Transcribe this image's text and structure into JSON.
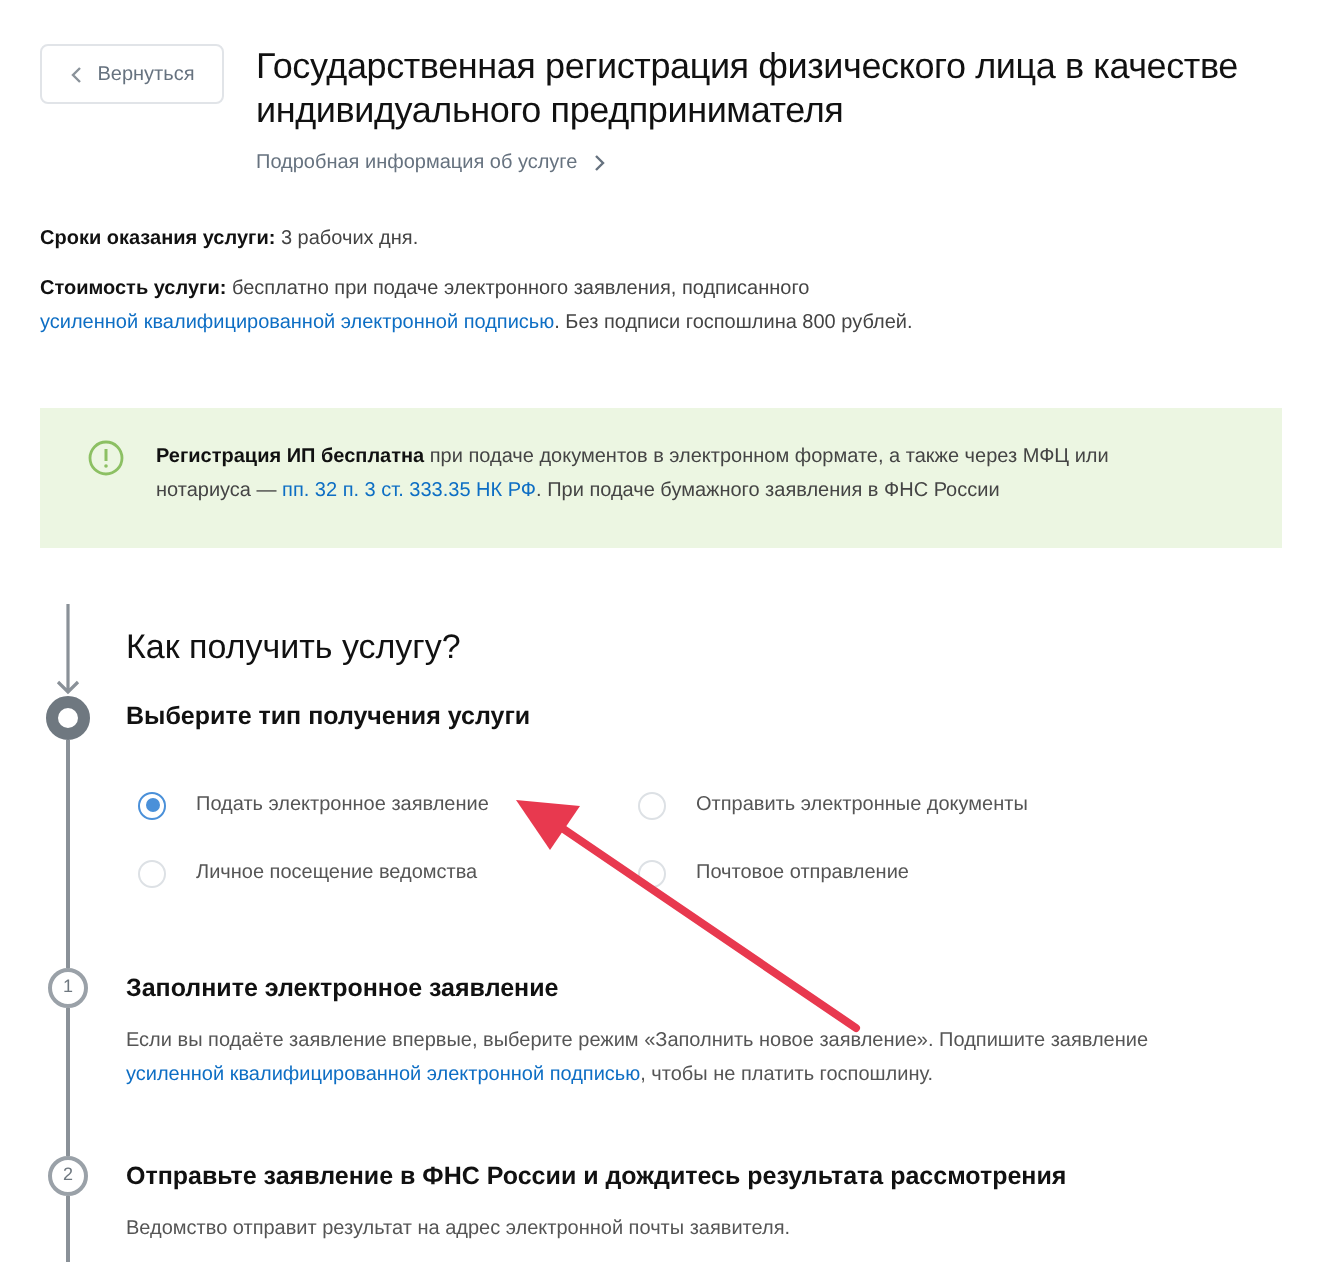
{
  "back_button": {
    "label": "Вернуться"
  },
  "title": "Государственная регистрация физического лица в качестве индивидуального предпринимателя",
  "details_link": "Подробная информация об услуге",
  "facts": [
    {
      "parts": [
        {
          "text": "**Сроки оказания услуги:** 3 рабочих дня.",
          "link": false
        }
      ]
    },
    {
      "parts": [
        {
          "text": "**Стоимость услуги:** бесплатно при подаче электронного заявления, подписанного ",
          "link": false
        },
        {
          "text": "усиленной квалифицированной электронной подписью",
          "link": true
        },
        {
          "text": ". Без подписи госпошлина 800 рублей.",
          "link": false
        }
      ]
    }
  ],
  "notice": {
    "parts": [
      {
        "text": "**Регистрация ИП бесплатна** при подаче документов в электронном формате, а также через МФЦ или нотариуса — ",
        "link": false
      },
      {
        "text": "пп. 32 п. 3 ст. 333.35 НК РФ",
        "link": true
      },
      {
        "text": ". При подаче бумажного заявления в ФНС России",
        "link": false
      }
    ]
  },
  "section_title": "Как получить услугу?",
  "steps": [
    {
      "kind": "choice",
      "title": "Выберите тип получения услуги",
      "options": [
        {
          "label": "Подать электронное заявление",
          "selected": true
        },
        {
          "label": "Отправить электронные документы",
          "selected": false
        },
        {
          "label": "Личное посещение ведомства",
          "selected": false
        },
        {
          "label": "Почтовое отправление",
          "selected": false
        }
      ]
    },
    {
      "kind": "numbered",
      "number": "1",
      "title": "Заполните электронное заявление",
      "parts": [
        {
          "text": "Если вы подаёте заявление впервые, выберите режим «Заполнить новое заявление». Подпишите заявление ",
          "link": false
        },
        {
          "text": "усиленной квалифицированной электронной подписью",
          "link": true
        },
        {
          "text": ", чтобы не платить госпошлину.",
          "link": false
        }
      ]
    },
    {
      "kind": "numbered",
      "number": "2",
      "title": "Отправьте заявление в ФНС России и дождитесь результата рассмотрения",
      "parts": [
        {
          "text": "Ведомство отправит результат на адрес электронной почты заявителя.",
          "link": false
        }
      ]
    }
  ]
}
